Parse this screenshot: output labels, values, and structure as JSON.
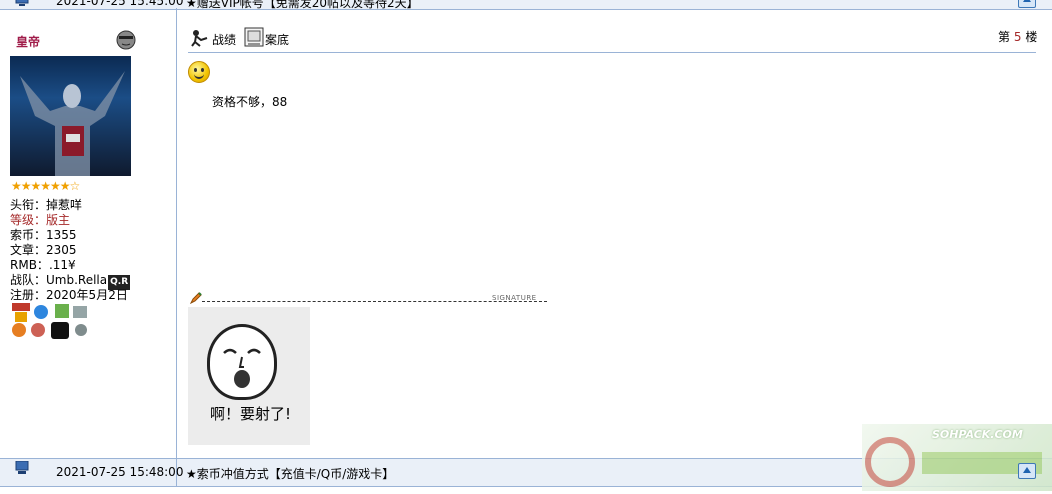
{
  "prev_post": {
    "timestamp": "2021-07-25 15:45:00",
    "title": "★赠送VIP帐号【免需发20帖以及等待2天】"
  },
  "user": {
    "name": "皇帝",
    "stars": "★★★★★★☆",
    "fields": [
      {
        "label": "头衔：",
        "value": "掉惹咩"
      },
      {
        "label": "等级：",
        "value": "版主"
      },
      {
        "label": "索币：",
        "value": "1355"
      },
      {
        "label": "文章：",
        "value": "2305"
      },
      {
        "label": "RMB：",
        "value": ".11¥"
      },
      {
        "label": "战队：",
        "value": "Umb.Rella"
      },
      {
        "label": "注册：",
        "value": "2020年5月2日"
      }
    ],
    "team_badge": "Q.R"
  },
  "toolbar": {
    "record_label": "战绩",
    "case_label": "案底"
  },
  "floor": {
    "prefix": "第",
    "number": "5",
    "suffix": "楼"
  },
  "post": {
    "body": "资格不够，88"
  },
  "signature": {
    "word": "SIGNATURE",
    "sticker_text": "啊！要射了!"
  },
  "next_post": {
    "timestamp": "2021-07-25 15:48:00",
    "title": "★索币冲值方式【充值卡/Q币/游戏卡】"
  },
  "watermark": {
    "text": "SOHPACK.COM"
  },
  "colors": {
    "border": "#9ab3d6",
    "header_bg": "#eaf0f8",
    "accent_red": "#a52a2a"
  }
}
